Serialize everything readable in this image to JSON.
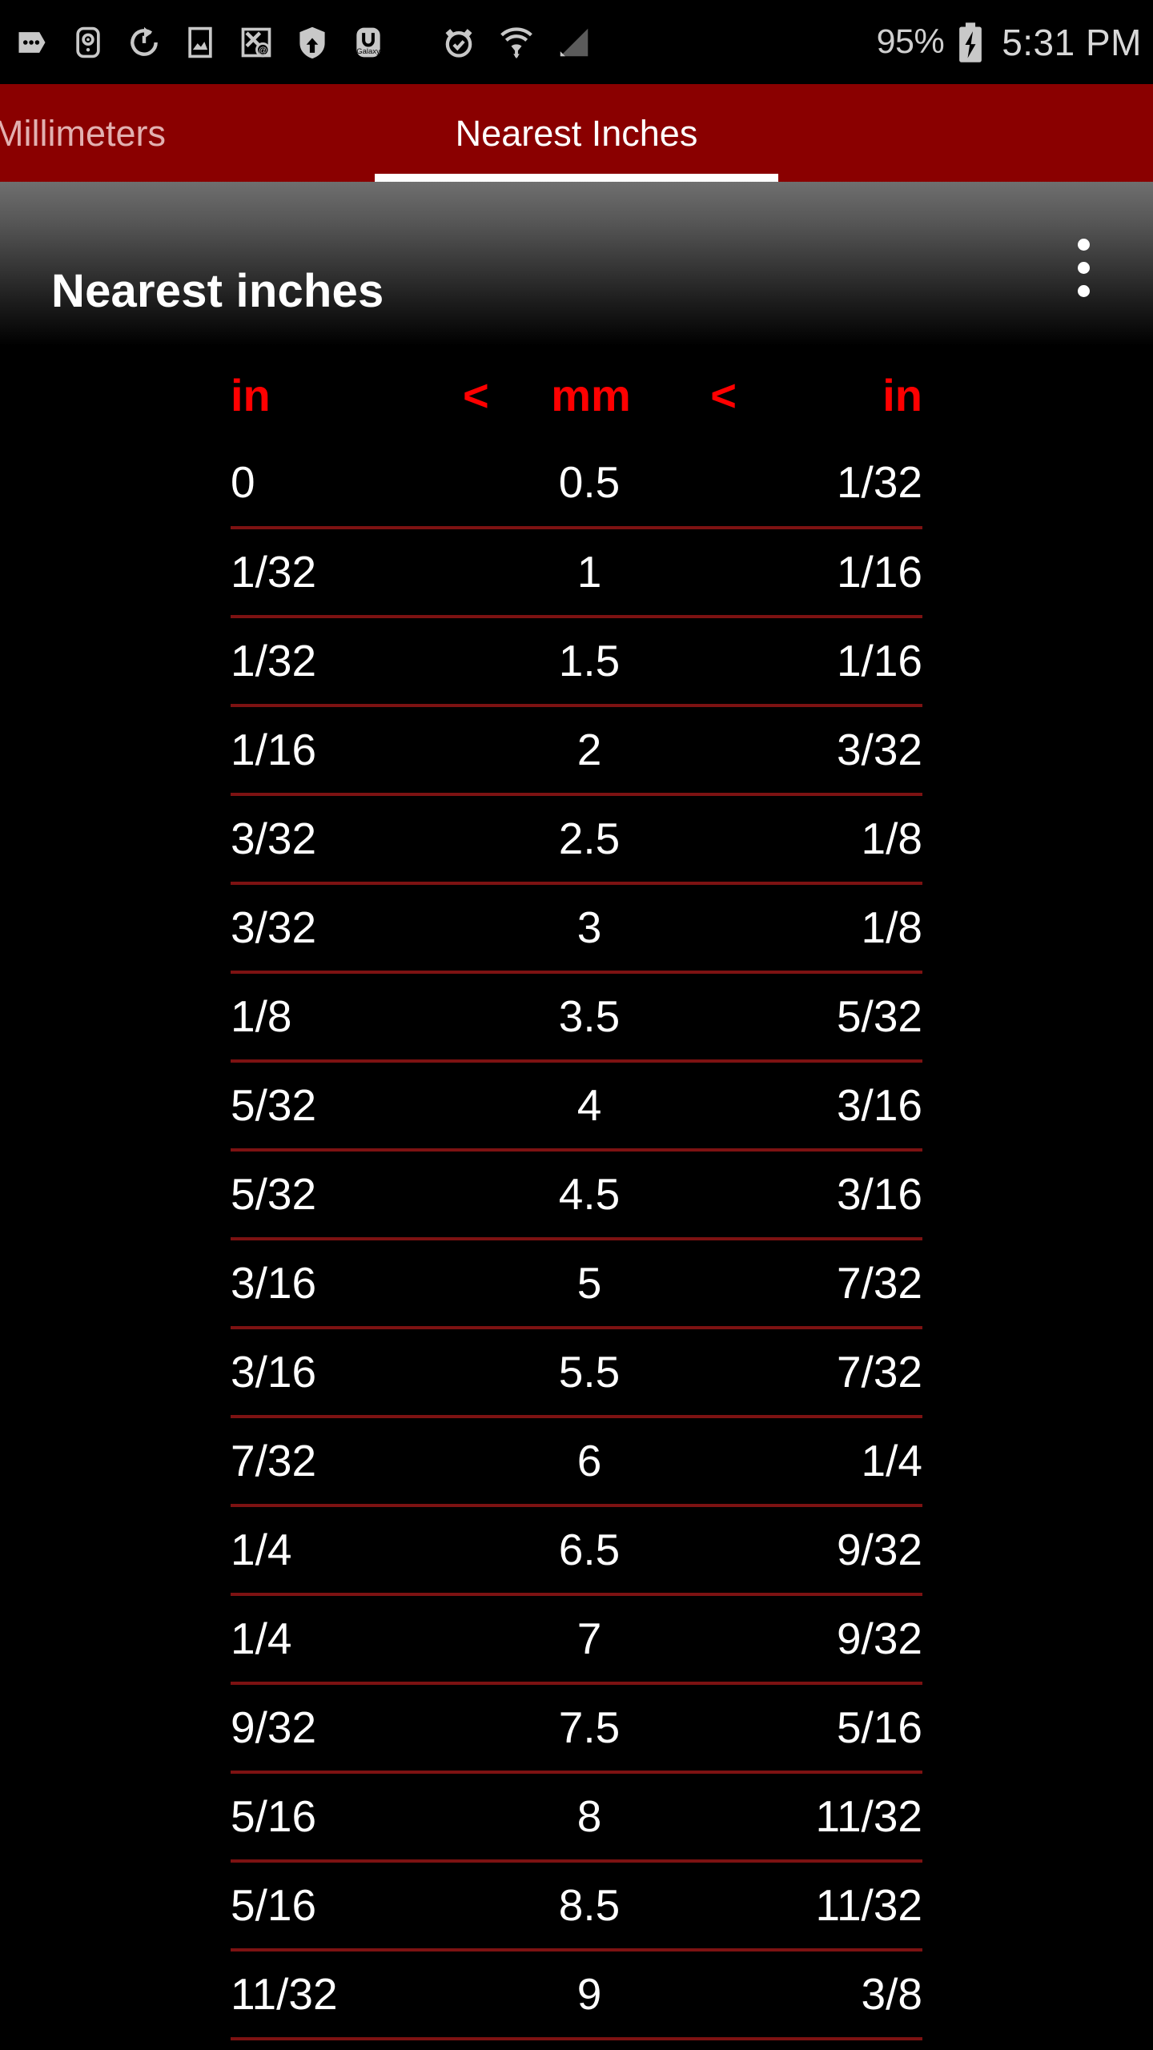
{
  "status_bar": {
    "icons": [
      "messages-icon",
      "phone-remote-icon",
      "sync-icon",
      "screenshot-icon",
      "email-sync-off-icon",
      "security-shield-icon",
      "galaxy-apps-icon",
      "alarm-icon",
      "wifi-icon",
      "cellular-signal-icon"
    ],
    "battery_percent": "95%",
    "battery_icon": "battery-charging-icon",
    "time": "5:31 PM"
  },
  "tabs": {
    "items": [
      {
        "label": "Millimeters",
        "active": false
      },
      {
        "label": "Nearest Inches",
        "active": true
      }
    ]
  },
  "header": {
    "title": "Nearest inches",
    "overflow_icon": "overflow-menu-icon"
  },
  "colors": {
    "accent_red": "#8a0000",
    "header_text_red": "#ff0000",
    "row_divider": "#7d1212",
    "background": "#000000",
    "text": "#ffffff",
    "inactive_tab_text": "#e2b0b0"
  },
  "table": {
    "headers": [
      "in",
      "<",
      "mm",
      "<",
      "in"
    ],
    "rows": [
      [
        "0",
        "0.5",
        "1/32"
      ],
      [
        "1/32",
        "1",
        "1/16"
      ],
      [
        "1/32",
        "1.5",
        "1/16"
      ],
      [
        "1/16",
        "2",
        "3/32"
      ],
      [
        "3/32",
        "2.5",
        "1/8"
      ],
      [
        "3/32",
        "3",
        "1/8"
      ],
      [
        "1/8",
        "3.5",
        "5/32"
      ],
      [
        "5/32",
        "4",
        "3/16"
      ],
      [
        "5/32",
        "4.5",
        "3/16"
      ],
      [
        "3/16",
        "5",
        "7/32"
      ],
      [
        "3/16",
        "5.5",
        "7/32"
      ],
      [
        "7/32",
        "6",
        "1/4"
      ],
      [
        "1/4",
        "6.5",
        "9/32"
      ],
      [
        "1/4",
        "7",
        "9/32"
      ],
      [
        "9/32",
        "7.5",
        "5/16"
      ],
      [
        "5/16",
        "8",
        "11/32"
      ],
      [
        "5/16",
        "8.5",
        "11/32"
      ],
      [
        "11/32",
        "9",
        "3/8"
      ]
    ]
  }
}
